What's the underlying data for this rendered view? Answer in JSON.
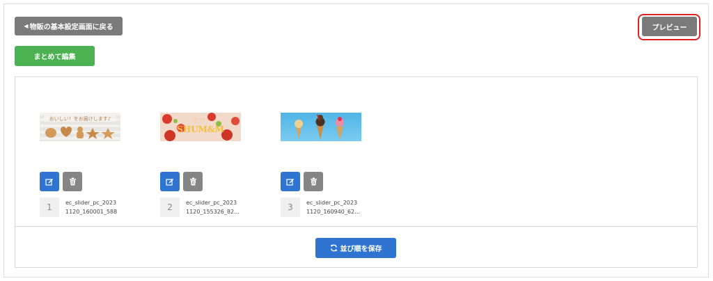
{
  "header": {
    "back_label": "物販の基本設定画面に戻る",
    "bulk_edit_label": "まとめて編集",
    "preview_label": "プレビュー"
  },
  "slides": [
    {
      "index": "1",
      "filename_line1": "ec_slider_pc_2023",
      "filename_line2": "1120_160001_588"
    },
    {
      "index": "2",
      "filename_line1": "ec_slider_pc_2023",
      "filename_line2": "1120_155326_82…"
    },
    {
      "index": "3",
      "filename_line1": "ec_slider_pc_2023",
      "filename_line2": "1120_160940_62…"
    }
  ],
  "banners": {
    "cookie_text": "おいしい！をお届けします♪",
    "strawberry_text": "SHUM&M"
  },
  "footer": {
    "save_label": "並び順を保存"
  },
  "colors": {
    "gray_button": "#7a7a7a",
    "green_button": "#4cb150",
    "blue_button": "#2f74d0",
    "highlight_border": "#e02020"
  },
  "icons": {
    "back": "caret-left-icon",
    "edit": "edit-icon",
    "delete": "trash-icon",
    "save": "refresh-icon"
  }
}
